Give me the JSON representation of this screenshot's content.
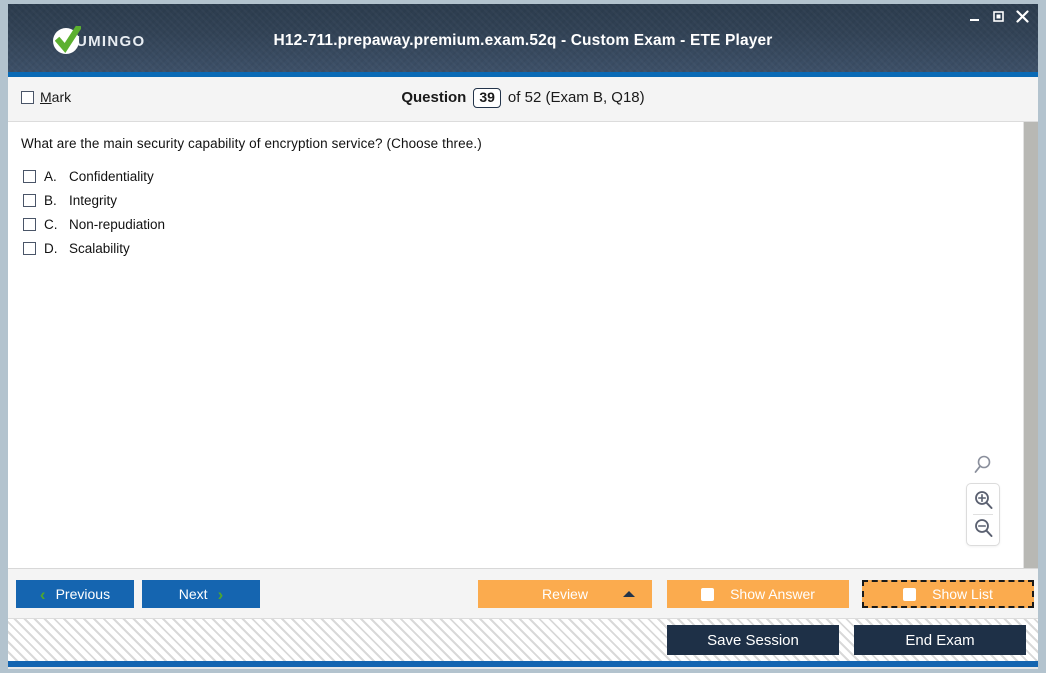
{
  "window": {
    "title": "H12-711.prepaway.premium.exam.52q - Custom Exam - ETE Player",
    "logo_text": "UMINGO",
    "controls": {
      "minimize": "–",
      "maximize": "☐",
      "close": "✕"
    }
  },
  "question_bar": {
    "mark_accel": "M",
    "mark_rest": "ark",
    "question_word": "Question",
    "question_number": "39",
    "question_of": "of 52 (Exam B, Q18)"
  },
  "question": {
    "text": "What are the main security capability of encryption service? (Choose three.)",
    "options": [
      {
        "letter": "A.",
        "text": "Confidentiality",
        "checked": false
      },
      {
        "letter": "B.",
        "text": "Integrity",
        "checked": false
      },
      {
        "letter": "C.",
        "text": "Non-repudiation",
        "checked": false
      },
      {
        "letter": "D.",
        "text": "Scalability",
        "checked": false
      }
    ]
  },
  "toolbar": {
    "previous_label": "Previous",
    "next_label": "Next",
    "review_label": "Review",
    "show_answer_label": "Show Answer",
    "show_list_label": "Show List",
    "prev_chevron": "‹",
    "next_chevron": "›"
  },
  "footer": {
    "save_session_label": "Save Session",
    "end_exam_label": "End Exam"
  },
  "colors": {
    "accent_blue": "#1565b0",
    "header_navy": "#2c3c4e",
    "orange": "#fbab4e",
    "green": "#4ea72e",
    "dark_button": "#1e3047"
  }
}
